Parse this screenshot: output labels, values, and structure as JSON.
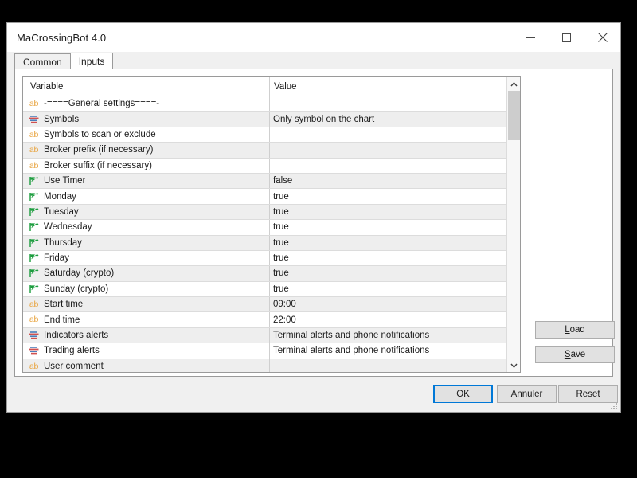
{
  "window": {
    "title": "MaCrossingBot 4.0",
    "controls": [
      {
        "name": "minimize-button",
        "glyph": "minimize"
      },
      {
        "name": "maximize-button",
        "glyph": "maximize"
      },
      {
        "name": "close-button",
        "glyph": "close"
      }
    ]
  },
  "tabs": [
    {
      "label": "Common",
      "active": false
    },
    {
      "label": "Inputs",
      "active": true
    }
  ],
  "table": {
    "headers": {
      "variable": "Variable",
      "value": "Value"
    },
    "rows": [
      {
        "icon": "ab-string-icon",
        "type": "ab",
        "variable": "-====General settings====-",
        "value": ""
      },
      {
        "icon": "enum-list-icon",
        "type": "enum",
        "variable": "Symbols",
        "value": "Only symbol on the chart"
      },
      {
        "icon": "ab-string-icon",
        "type": "ab",
        "variable": "Symbols to scan or exclude",
        "value": ""
      },
      {
        "icon": "ab-string-icon",
        "type": "ab",
        "variable": "Broker prefix (if necessary)",
        "value": ""
      },
      {
        "icon": "ab-string-icon",
        "type": "ab",
        "variable": "Broker suffix (if necessary)",
        "value": ""
      },
      {
        "icon": "bool-flag-icon",
        "type": "bool",
        "variable": "Use Timer",
        "value": "false"
      },
      {
        "icon": "bool-flag-icon",
        "type": "bool",
        "variable": "Monday",
        "value": "true"
      },
      {
        "icon": "bool-flag-icon",
        "type": "bool",
        "variable": "Tuesday",
        "value": "true"
      },
      {
        "icon": "bool-flag-icon",
        "type": "bool",
        "variable": "Wednesday",
        "value": "true"
      },
      {
        "icon": "bool-flag-icon",
        "type": "bool",
        "variable": "Thursday",
        "value": "true"
      },
      {
        "icon": "bool-flag-icon",
        "type": "bool",
        "variable": "Friday",
        "value": "true"
      },
      {
        "icon": "bool-flag-icon",
        "type": "bool",
        "variable": "Saturday (crypto)",
        "value": "true"
      },
      {
        "icon": "bool-flag-icon",
        "type": "bool",
        "variable": "Sunday (crypto)",
        "value": "true"
      },
      {
        "icon": "ab-string-icon",
        "type": "ab",
        "variable": "Start time",
        "value": "09:00"
      },
      {
        "icon": "ab-string-icon",
        "type": "ab",
        "variable": "End time",
        "value": "22:00"
      },
      {
        "icon": "enum-list-icon",
        "type": "enum",
        "variable": "Indicators alerts",
        "value": "Terminal alerts and phone notifications"
      },
      {
        "icon": "enum-list-icon",
        "type": "enum",
        "variable": "Trading alerts",
        "value": "Terminal alerts and phone notifications"
      },
      {
        "icon": "ab-string-icon",
        "type": "ab",
        "variable": "User comment",
        "value": ""
      }
    ]
  },
  "side_buttons": {
    "load": {
      "prefix": "",
      "accel": "L",
      "rest": "oad"
    },
    "save": {
      "prefix": "",
      "accel": "S",
      "rest": "ave"
    }
  },
  "footer_buttons": {
    "ok": "OK",
    "cancel": "Annuler",
    "reset": "Reset"
  },
  "colors": {
    "accent": "#0078d7",
    "string_icon": "#e8a33d",
    "bool_icon": "#1a9c3c",
    "enum_icon_blue": "#4a7ebb",
    "enum_icon_red": "#d05050",
    "row_alt": "#eeeeee",
    "window_bg": "#f0f0f0"
  },
  "scrollbar": {
    "position": "top",
    "thumb_fraction": 0.18
  }
}
